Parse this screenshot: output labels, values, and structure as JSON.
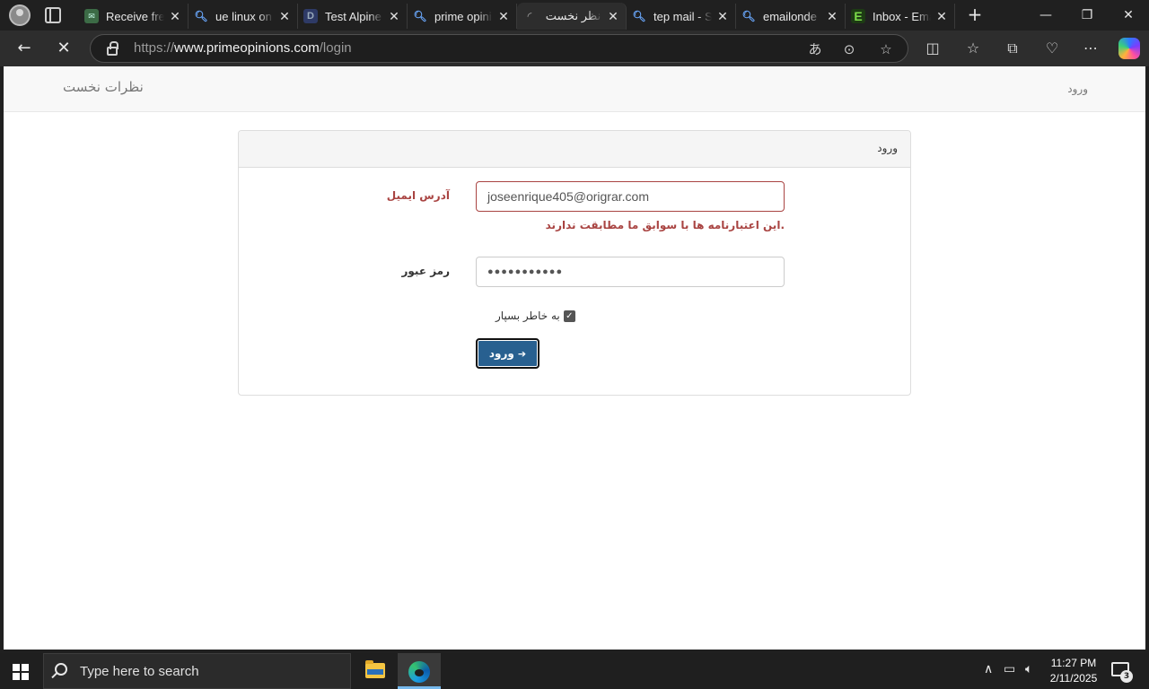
{
  "browser": {
    "tabs": [
      {
        "title": "Receive free",
        "favicon": "message-icon"
      },
      {
        "title": "ue linux on",
        "favicon": "search-icon"
      },
      {
        "title": "Test Alpine",
        "favicon": "d-icon"
      },
      {
        "title": "prime opini",
        "favicon": "search-icon"
      },
      {
        "title": "نظر نخست",
        "favicon": "loading-icon",
        "active": true
      },
      {
        "title": "tep mail - S",
        "favicon": "search-icon"
      },
      {
        "title": "emailonde",
        "favicon": "search-icon"
      },
      {
        "title": "Inbox - Ema",
        "favicon": "e-icon"
      }
    ],
    "url": {
      "scheme": "https://",
      "host": "www.primeopinions.com",
      "path": "/login"
    }
  },
  "page": {
    "brand": "نظرات نخست",
    "nav_login": "ورود",
    "panel_title": "ورود",
    "email_label": "آدرس ایمیل",
    "email_value": "joseenrique405@origrar.com",
    "email_error": "این اعتبارنامه ها با سوابق ما مطابقت ندارند.",
    "password_label": "رمز عبور",
    "password_mask": "●●●●●●●●●●●",
    "remember_label": "به خاطر بسپار",
    "remember_checked": true,
    "submit_label": "ورود"
  },
  "taskbar": {
    "search_placeholder": "Type here to search",
    "time": "11:27 PM",
    "date": "2/11/2025",
    "notification_count": "3"
  },
  "colors": {
    "error": "#a94442",
    "button": "#286090",
    "browser_frame": "#202020"
  }
}
